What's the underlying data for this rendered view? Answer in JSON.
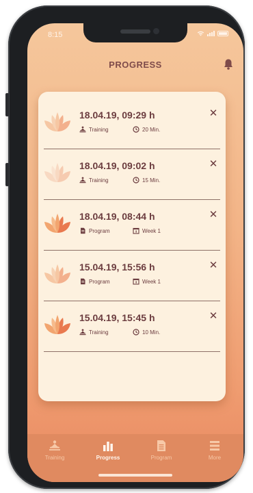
{
  "status_bar": {
    "time": "8:15"
  },
  "header": {
    "title": "PROGRESS",
    "bell_icon": "bell-icon"
  },
  "entries": [
    {
      "title": "18.04.19, 09:29 h",
      "type": "Training",
      "type_icon": "meditation-icon",
      "detail": "20 Min.",
      "detail_icon": "clock-icon",
      "lotus_shade": "light"
    },
    {
      "title": "18.04.19, 09:02 h",
      "type": "Training",
      "type_icon": "meditation-icon",
      "detail": "15 Min.",
      "detail_icon": "clock-icon",
      "lotus_shade": "pale"
    },
    {
      "title": "18.04.19, 08:44 h",
      "type": "Program",
      "type_icon": "document-icon",
      "detail": "Week 1",
      "detail_icon": "calendar-icon",
      "lotus_shade": "deep"
    },
    {
      "title": "15.04.19, 15:56 h",
      "type": "Program",
      "type_icon": "document-icon",
      "detail": "Week 1",
      "detail_icon": "calendar-icon",
      "lotus_shade": "light"
    },
    {
      "title": "15.04.19, 15:45 h",
      "type": "Training",
      "type_icon": "meditation-icon",
      "detail": "10 Min.",
      "detail_icon": "clock-icon",
      "lotus_shade": "deep"
    }
  ],
  "close_glyph": "✕",
  "tabbar": {
    "tabs": [
      {
        "label": "Training",
        "icon": "meditation-icon",
        "active": false
      },
      {
        "label": "Progress",
        "icon": "bar-chart-icon",
        "active": true
      },
      {
        "label": "Program",
        "icon": "document-icon",
        "active": false
      },
      {
        "label": "More",
        "icon": "menu-icon",
        "active": false
      }
    ]
  },
  "colors": {
    "accent_text": "#6b3c3f",
    "card_bg": "#fdf1df",
    "tabbar_bg": "#e08a60"
  }
}
